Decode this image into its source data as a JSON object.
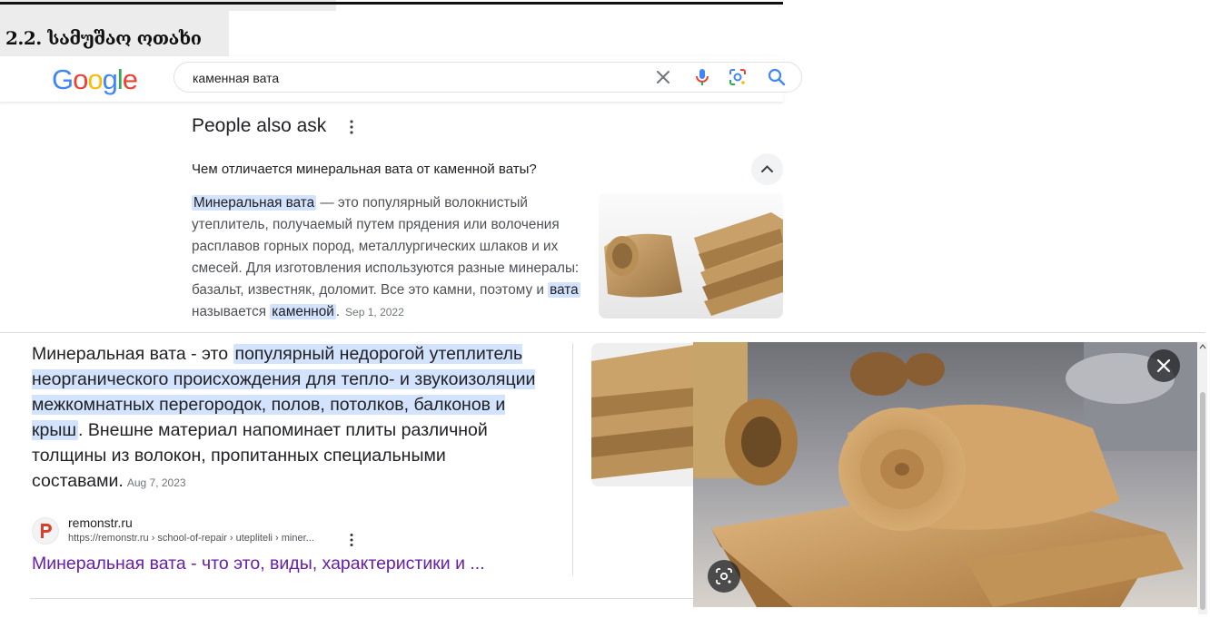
{
  "document": {
    "heading": "2.2. სამუშაო ოთახი"
  },
  "google": {
    "logo_letters": [
      {
        "ch": "G",
        "color": "#4285F4"
      },
      {
        "ch": "o",
        "color": "#EA4335"
      },
      {
        "ch": "o",
        "color": "#FBBC05"
      },
      {
        "ch": "g",
        "color": "#4285F4"
      },
      {
        "ch": "l",
        "color": "#34A853"
      },
      {
        "ch": "e",
        "color": "#EA4335"
      }
    ],
    "search_query": "каменная вата"
  },
  "paa": {
    "title": "People also ask",
    "question": "Чем отличается минеральная вата от каменной ваты?",
    "answer": {
      "hl1": "Минеральная вата",
      "part1": " — это популярный волокнистый утеплитель, получаемый путем прядения или волочения расплавов горных пород, металлургических шлаков и их смесей. Для изготовления используются разные минералы: базальт, известняк, доломит. Все это камни, поэтому и ",
      "hl2": "вата",
      "part2": " называется ",
      "hl3": "каменной",
      "part3": ".",
      "date": "Sep 1, 2022"
    }
  },
  "snippet": {
    "lead": "Минеральная вата - это ",
    "highlight": "популярный недорогой утеплитель неорганического происхождения для тепло- и звукоизоляции межкомнатных перегородок, полов, потолков, балконов и крыш",
    "tail": ". Внешне материал напоминает плиты различной толщины из волокон, пропитанных специальными составами.",
    "date": "Aug 7, 2023",
    "source_site": "remonstr.ru",
    "source_url": "https://remonstr.ru › school-of-repair › utepliteli › miner...",
    "result_title": "Минеральная вата - что это, виды, характеристики и ..."
  },
  "colors": {
    "highlight": "#d3e3fd",
    "link_visited": "#681da8",
    "favicon_red": "#d9402b"
  }
}
